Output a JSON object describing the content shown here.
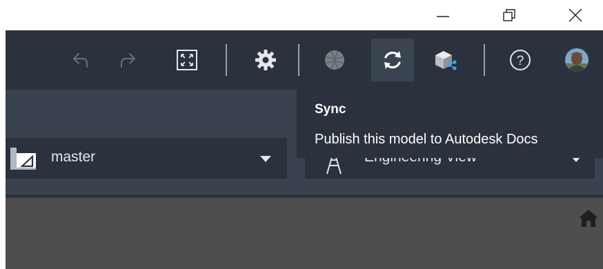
{
  "window": {
    "minimize_icon": "minimize-icon",
    "maximize_icon": "restore-icon",
    "close_icon": "close-icon"
  },
  "toolbar": {
    "items": [
      {
        "icon": "undo-icon"
      },
      {
        "icon": "redo-icon"
      },
      {
        "icon": "fullscreen-icon"
      },
      {
        "icon": "gear-icon"
      },
      {
        "icon": "globe-icon"
      },
      {
        "icon": "sync-icon",
        "active": true
      },
      {
        "icon": "model-share-icon"
      },
      {
        "icon": "help-icon"
      },
      {
        "icon": "avatar"
      }
    ]
  },
  "branch_dropdown": {
    "icon": "blueprint-icon",
    "value": "master"
  },
  "view_dropdown": {
    "icon": "tower-icon",
    "value": "Engineering View"
  },
  "tooltip": {
    "title": "Sync",
    "description": "Publish this model to Autodesk Docs"
  },
  "viewport": {
    "home_icon": "home-icon"
  },
  "colors": {
    "toolbar_bg": "#2b323d",
    "panel_bg": "#3a4250",
    "viewport_bg": "#4e4e4e",
    "text_light": "#e4e7eb"
  }
}
